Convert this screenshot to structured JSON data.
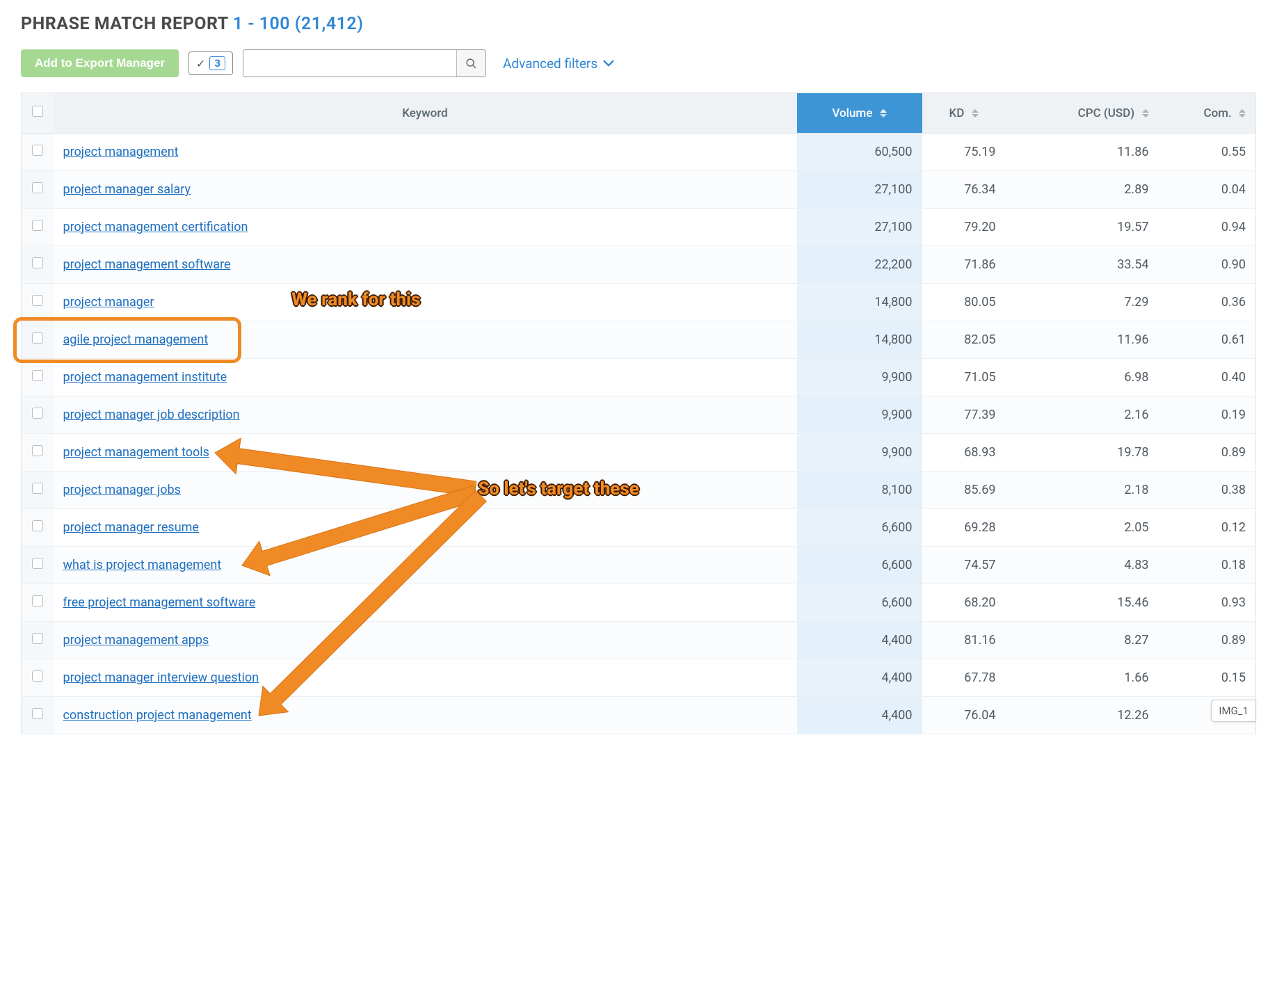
{
  "header": {
    "title": "PHRASE MATCH REPORT",
    "range": "1 - 100 (21,412)"
  },
  "toolbar": {
    "export_label": "Add to Export Manager",
    "selected_count": "3",
    "adv_filters_label": "Advanced filters"
  },
  "columns": {
    "keyword": "Keyword",
    "volume": "Volume",
    "kd": "KD",
    "cpc": "CPC (USD)",
    "com": "Com."
  },
  "rows": [
    {
      "keyword": "project management",
      "volume": "60,500",
      "kd": "75.19",
      "cpc": "11.86",
      "com": "0.55"
    },
    {
      "keyword": "project manager salary",
      "volume": "27,100",
      "kd": "76.34",
      "cpc": "2.89",
      "com": "0.04"
    },
    {
      "keyword": "project management certification",
      "volume": "27,100",
      "kd": "79.20",
      "cpc": "19.57",
      "com": "0.94"
    },
    {
      "keyword": "project management software",
      "volume": "22,200",
      "kd": "71.86",
      "cpc": "33.54",
      "com": "0.90"
    },
    {
      "keyword": "project manager",
      "volume": "14,800",
      "kd": "80.05",
      "cpc": "7.29",
      "com": "0.36"
    },
    {
      "keyword": "agile project management",
      "volume": "14,800",
      "kd": "82.05",
      "cpc": "11.96",
      "com": "0.61"
    },
    {
      "keyword": "project management institute",
      "volume": "9,900",
      "kd": "71.05",
      "cpc": "6.98",
      "com": "0.40"
    },
    {
      "keyword": "project manager job description",
      "volume": "9,900",
      "kd": "77.39",
      "cpc": "2.16",
      "com": "0.19"
    },
    {
      "keyword": "project management tools",
      "volume": "9,900",
      "kd": "68.93",
      "cpc": "19.78",
      "com": "0.89"
    },
    {
      "keyword": "project manager jobs",
      "volume": "8,100",
      "kd": "85.69",
      "cpc": "2.18",
      "com": "0.38"
    },
    {
      "keyword": "project manager resume",
      "volume": "6,600",
      "kd": "69.28",
      "cpc": "2.05",
      "com": "0.12"
    },
    {
      "keyword": "what is project management",
      "volume": "6,600",
      "kd": "74.57",
      "cpc": "4.83",
      "com": "0.18"
    },
    {
      "keyword": "free project management software",
      "volume": "6,600",
      "kd": "68.20",
      "cpc": "15.46",
      "com": "0.93"
    },
    {
      "keyword": "project management apps",
      "volume": "4,400",
      "kd": "81.16",
      "cpc": "8.27",
      "com": "0.89"
    },
    {
      "keyword": "project manager interview question",
      "volume": "4,400",
      "kd": "67.78",
      "cpc": "1.66",
      "com": "0.15"
    },
    {
      "keyword": "construction project management",
      "volume": "4,400",
      "kd": "76.04",
      "cpc": "12.26",
      "com": ""
    }
  ],
  "annotations": {
    "rank_text": "We rank for this",
    "target_text": "So let's target these",
    "chip_label": "IMG_1"
  }
}
